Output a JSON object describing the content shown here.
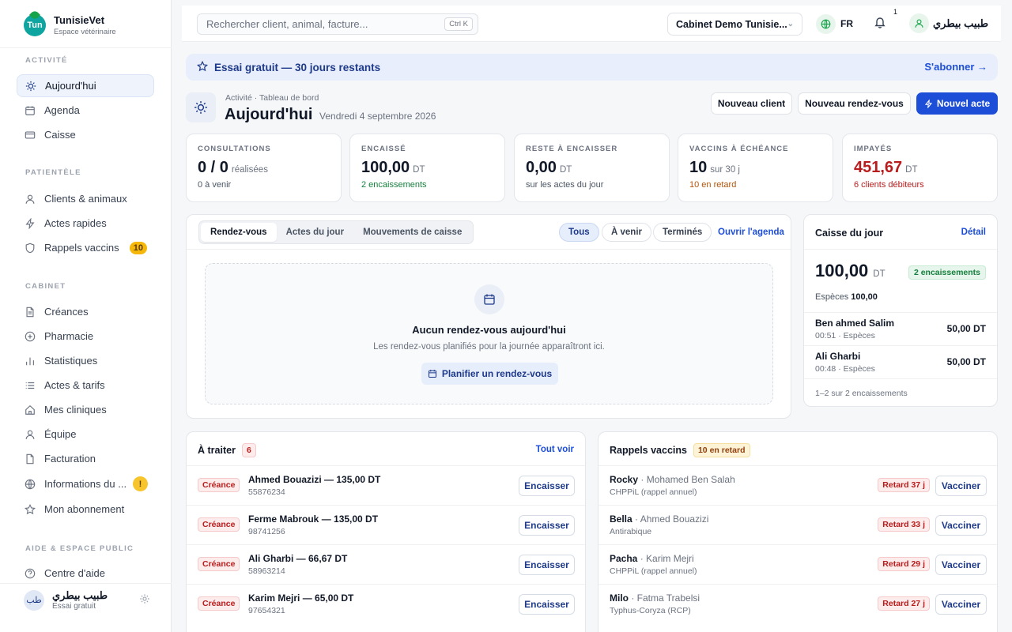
{
  "brand": {
    "name": "TunisieVet",
    "subtitle": "Espace vétérinaire",
    "logo_text": "Tun"
  },
  "sidebar": {
    "sections": {
      "activite": "ACTIVITÉ",
      "patientele": "PATIENTÈLE",
      "cabinet": "CABINET",
      "aide": "AIDE & ESPACE PUBLIC"
    },
    "activite": [
      {
        "label": "Aujourd'hui",
        "icon": "sun-icon",
        "active": true
      },
      {
        "label": "Agenda",
        "icon": "calendar-icon"
      },
      {
        "label": "Caisse",
        "icon": "card-icon"
      }
    ],
    "patientele": [
      {
        "label": "Clients & animaux",
        "icon": "user-icon"
      },
      {
        "label": "Actes rapides",
        "icon": "bolt-icon"
      },
      {
        "label": "Rappels vaccins",
        "icon": "shield-icon",
        "badge": "10"
      }
    ],
    "cabinet": [
      {
        "label": "Créances",
        "icon": "document-icon"
      },
      {
        "label": "Pharmacie",
        "icon": "plus-circle-icon"
      },
      {
        "label": "Statistiques",
        "icon": "bar-chart-icon"
      },
      {
        "label": "Actes & tarifs",
        "icon": "list-icon"
      },
      {
        "label": "Mes cliniques",
        "icon": "home-icon"
      },
      {
        "label": "Équipe",
        "icon": "user-icon"
      },
      {
        "label": "Facturation",
        "icon": "file-icon"
      },
      {
        "label": "Informations du ...",
        "icon": "globe-icon",
        "warning": "!"
      },
      {
        "label": "Mon abonnement",
        "icon": "star-icon"
      }
    ],
    "aide": [
      {
        "label": "Centre d'aide",
        "icon": "help-icon"
      }
    ],
    "footer": {
      "avatar": "طب",
      "name": "طبيب بيطري",
      "plan": "Essai gratuit"
    }
  },
  "topbar": {
    "search_placeholder": "Rechercher client, animal, facture...",
    "shortcut": "Ctrl K",
    "cabinet": "Cabinet Demo Tunisie...",
    "lang": "FR",
    "notifications": "1",
    "user_name": "طبيب بيطري"
  },
  "banner": {
    "text": "Essai gratuit — 30 jours restants",
    "link": "S'abonner →"
  },
  "header": {
    "breadcrumb": "Activité · Tableau de bord",
    "title": "Aujourd'hui",
    "date": "Vendredi 4 septembre 2026",
    "buttons": {
      "new_client": "Nouveau client",
      "new_rdv": "Nouveau rendez-vous",
      "new_act": "Nouvel acte"
    }
  },
  "stats": [
    {
      "label": "CONSULTATIONS",
      "value": "0 / 0",
      "unit": "réalisées",
      "sub": "0 à venir",
      "sub_color": "#4b5563"
    },
    {
      "label": "ENCAISSÉ",
      "value": "100,00",
      "unit": "DT",
      "sub": "2 encaissements",
      "sub_color": "#15803d"
    },
    {
      "label": "RESTE À ENCAISSER",
      "value": "0,00",
      "unit": "DT",
      "sub": "sur les actes du jour",
      "sub_color": "#4b5563"
    },
    {
      "label": "VACCINS À ÉCHÉANCE",
      "value": "10",
      "unit": "sur 30 j",
      "sub": "10 en retard",
      "sub_color": "#b45309"
    },
    {
      "label": "IMPAYÉS",
      "value": "451,67",
      "unit": "DT",
      "sub": "6 clients débiteurs",
      "sub_color": "#b91c1c",
      "value_color": "#b91c1c"
    }
  ],
  "rdv": {
    "tabs": [
      "Rendez-vous",
      "Actes du jour",
      "Mouvements de caisse"
    ],
    "filters": [
      "Tous",
      "À venir",
      "Terminés"
    ],
    "open_agenda": "Ouvrir l'agenda",
    "empty_title": "Aucun rendez-vous aujourd'hui",
    "empty_desc": "Les rendez-vous planifiés pour la journée apparaîtront ici.",
    "empty_button": "Planifier un rendez-vous"
  },
  "caisse": {
    "title": "Caisse du jour",
    "detail": "Détail",
    "total": "100,00",
    "unit": "DT",
    "badge": "2 encaissements",
    "especes_label": "Espèces",
    "especes_value": "100,00",
    "items": [
      {
        "name": "Ben ahmed Salim",
        "meta": "00:51 · Espèces",
        "amount": "50,00 DT"
      },
      {
        "name": "Ali Gharbi",
        "meta": "00:48 · Espèces",
        "amount": "50,00 DT"
      }
    ],
    "footer": "1–2 sur 2 encaissements"
  },
  "atraiter": {
    "title": "À traiter",
    "count": "6",
    "see_all": "Tout voir",
    "action": "Encaisser",
    "items": [
      {
        "tag": "Créance",
        "title": "Ahmed Bouazizi — 135,00 DT",
        "phone": "55876234"
      },
      {
        "tag": "Créance",
        "title": "Ferme Mabrouk — 135,00 DT",
        "phone": "98741256"
      },
      {
        "tag": "Créance",
        "title": "Ali Gharbi — 66,67 DT",
        "phone": "58963214"
      },
      {
        "tag": "Créance",
        "title": "Karim Mejri — 65,00 DT",
        "phone": "97654321"
      }
    ]
  },
  "rappels": {
    "title": "Rappels vaccins",
    "badge": "10 en retard",
    "action": "Vacciner",
    "items": [
      {
        "animal": "Rocky",
        "owner": "· Mohamed Ben Salah",
        "vaccine": "CHPPiL (rappel annuel)",
        "retard": "Retard 37 j"
      },
      {
        "animal": "Bella",
        "owner": "· Ahmed Bouazizi",
        "vaccine": "Antirabique",
        "retard": "Retard 33 j"
      },
      {
        "animal": "Pacha",
        "owner": "· Karim Mejri",
        "vaccine": "CHPPiL (rappel annuel)",
        "retard": "Retard 29 j"
      },
      {
        "animal": "Milo",
        "owner": "· Fatma Trabelsi",
        "vaccine": "Typhus-Coryza (RCP)",
        "retard": "Retard 27 j"
      }
    ]
  },
  "colors": {
    "primary": "#1d4ed8",
    "danger": "#b91c1c",
    "success": "#15803d",
    "warning": "#f5b70a"
  }
}
